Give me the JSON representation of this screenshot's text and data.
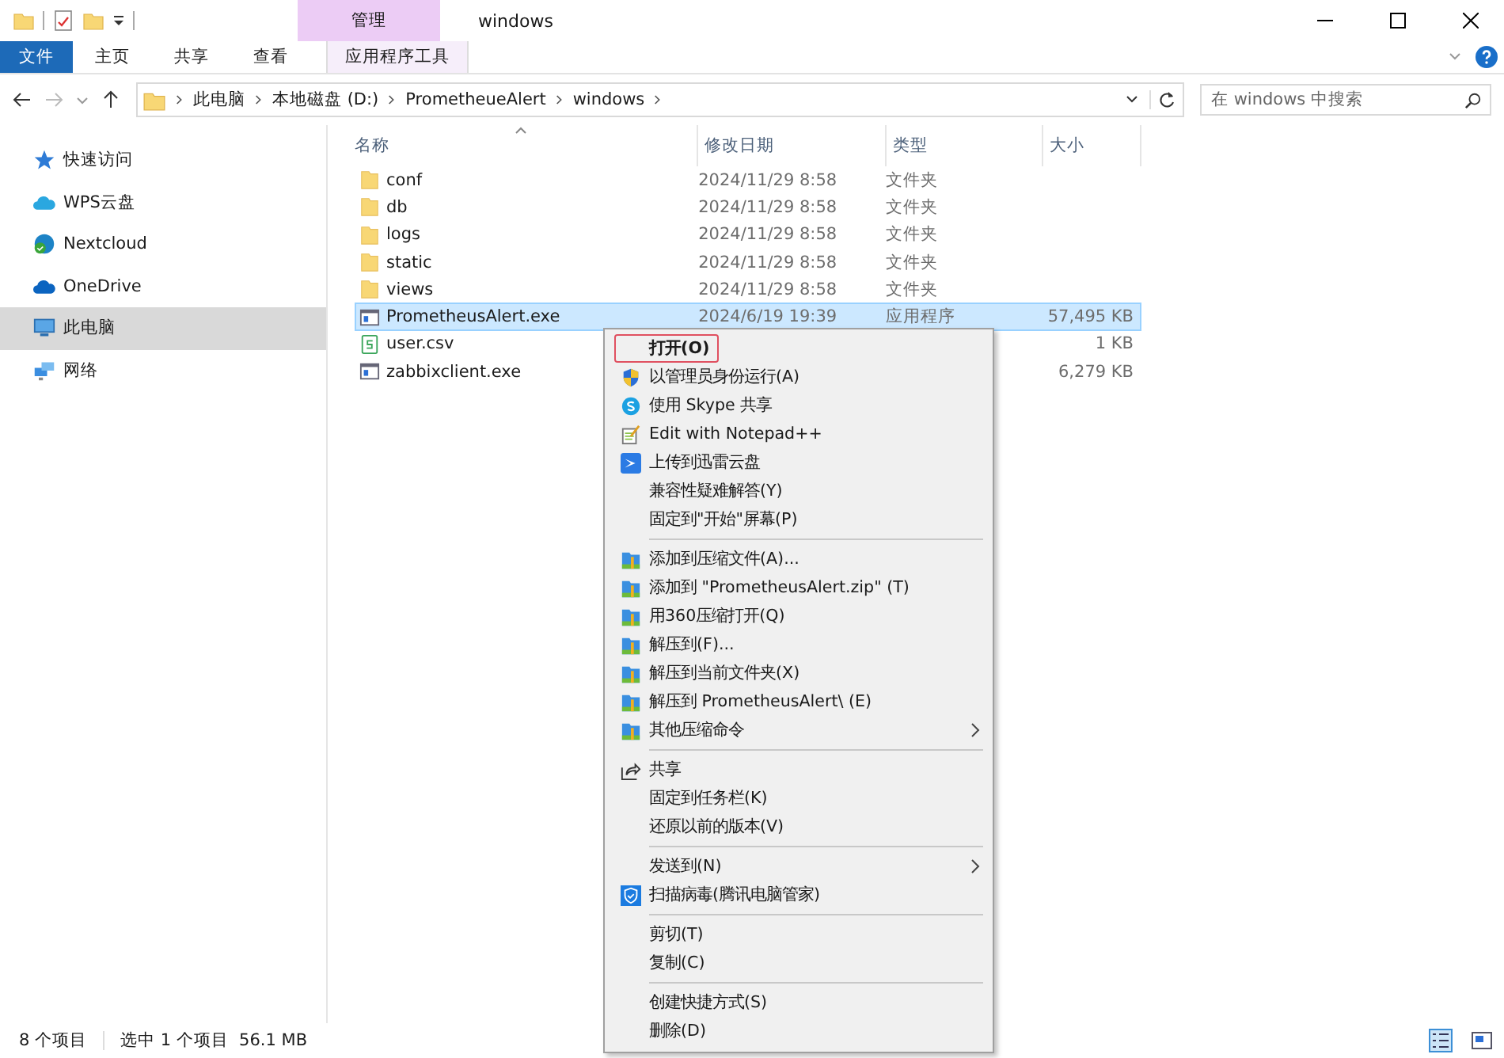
{
  "window": {
    "title": "windows",
    "context_tab": "管理"
  },
  "ribbon": {
    "tabs": [
      {
        "label": "文件",
        "kind": "file"
      },
      {
        "label": "主页",
        "kind": "plain"
      },
      {
        "label": "共享",
        "kind": "plain"
      },
      {
        "label": "查看",
        "kind": "plain"
      },
      {
        "label": "应用程序工具",
        "kind": "context"
      }
    ]
  },
  "address": {
    "crumbs": [
      "此电脑",
      "本地磁盘 (D:)",
      "PrometheueAlert",
      "windows"
    ],
    "search_placeholder": "在 windows 中搜索"
  },
  "sidebar": {
    "items": [
      {
        "label": "快速访问",
        "kind": "star",
        "selected": false
      },
      {
        "label": "WPS云盘",
        "kind": "cloud",
        "selected": false
      },
      {
        "label": "Nextcloud",
        "kind": "nextcloud",
        "selected": false
      },
      {
        "label": "OneDrive",
        "kind": "onedrive",
        "selected": false
      },
      {
        "label": "此电脑",
        "kind": "pc",
        "selected": true
      },
      {
        "label": "网络",
        "kind": "network",
        "selected": false
      }
    ]
  },
  "table": {
    "columns": [
      "名称",
      "修改日期",
      "类型",
      "大小"
    ],
    "rows": [
      {
        "name": "conf",
        "date": "2024/11/29 8:58",
        "type": "文件夹",
        "size": "",
        "kind": "folder",
        "selected": false
      },
      {
        "name": "db",
        "date": "2024/11/29 8:58",
        "type": "文件夹",
        "size": "",
        "kind": "folder",
        "selected": false
      },
      {
        "name": "logs",
        "date": "2024/11/29 8:58",
        "type": "文件夹",
        "size": "",
        "kind": "folder",
        "selected": false
      },
      {
        "name": "static",
        "date": "2024/11/29 8:58",
        "type": "文件夹",
        "size": "",
        "kind": "folder",
        "selected": false
      },
      {
        "name": "views",
        "date": "2024/11/29 8:58",
        "type": "文件夹",
        "size": "",
        "kind": "folder",
        "selected": false
      },
      {
        "name": "PrometheusAlert.exe",
        "date": "2024/6/19 19:39",
        "type": "应用程序",
        "size": "57,495 KB",
        "kind": "exe",
        "selected": true
      },
      {
        "name": "user.csv",
        "date": "",
        "type": "",
        "size": "1 KB",
        "kind": "csv",
        "selected": false
      },
      {
        "name": "zabbixclient.exe",
        "date": "",
        "type": "",
        "size": "6,279 KB",
        "kind": "exe",
        "selected": false
      }
    ]
  },
  "context_menu": {
    "groups": [
      [
        {
          "label": "打开(O)",
          "kind": "plain",
          "default": true,
          "highlighted": true,
          "submenu": false
        },
        {
          "label": "以管理员身份运行(A)",
          "kind": "shield",
          "default": false,
          "highlighted": false,
          "submenu": false
        },
        {
          "label": "使用 Skype 共享",
          "kind": "skype",
          "default": false,
          "highlighted": false,
          "submenu": false
        },
        {
          "label": "Edit with Notepad++",
          "kind": "notepad",
          "default": false,
          "highlighted": false,
          "submenu": false
        },
        {
          "label": "上传到迅雷云盘",
          "kind": "bird",
          "default": false,
          "highlighted": false,
          "submenu": false
        },
        {
          "label": "兼容性疑难解答(Y)",
          "kind": "plain",
          "default": false,
          "highlighted": false,
          "submenu": false
        },
        {
          "label": "固定到\"开始\"屏幕(P)",
          "kind": "plain",
          "default": false,
          "highlighted": false,
          "submenu": false
        }
      ],
      [
        {
          "label": "添加到压缩文件(A)...",
          "kind": "archive",
          "default": false,
          "highlighted": false,
          "submenu": false
        },
        {
          "label": "添加到 \"PrometheusAlert.zip\" (T)",
          "kind": "archive",
          "default": false,
          "highlighted": false,
          "submenu": false
        },
        {
          "label": "用360压缩打开(Q)",
          "kind": "archive",
          "default": false,
          "highlighted": false,
          "submenu": false
        },
        {
          "label": "解压到(F)...",
          "kind": "archive",
          "default": false,
          "highlighted": false,
          "submenu": false
        },
        {
          "label": "解压到当前文件夹(X)",
          "kind": "archive",
          "default": false,
          "highlighted": false,
          "submenu": false
        },
        {
          "label": "解压到 PrometheusAlert\\ (E)",
          "kind": "archive",
          "default": false,
          "highlighted": false,
          "submenu": false
        },
        {
          "label": "其他压缩命令",
          "kind": "archive",
          "default": false,
          "highlighted": false,
          "submenu": true
        }
      ],
      [
        {
          "label": "共享",
          "kind": "share",
          "default": false,
          "highlighted": false,
          "submenu": false
        },
        {
          "label": "固定到任务栏(K)",
          "kind": "plain",
          "default": false,
          "highlighted": false,
          "submenu": false
        },
        {
          "label": "还原以前的版本(V)",
          "kind": "plain",
          "default": false,
          "highlighted": false,
          "submenu": false
        }
      ],
      [
        {
          "label": "发送到(N)",
          "kind": "plain",
          "default": false,
          "highlighted": false,
          "submenu": true
        },
        {
          "label": "扫描病毒(腾讯电脑管家)",
          "kind": "virus",
          "default": false,
          "highlighted": false,
          "submenu": false
        }
      ],
      [
        {
          "label": "剪切(T)",
          "kind": "plain",
          "default": false,
          "highlighted": false,
          "submenu": false
        },
        {
          "label": "复制(C)",
          "kind": "plain",
          "default": false,
          "highlighted": false,
          "submenu": false
        }
      ],
      [
        {
          "label": "创建快捷方式(S)",
          "kind": "plain",
          "default": false,
          "highlighted": false,
          "submenu": false
        },
        {
          "label": "删除(D)",
          "kind": "plain",
          "default": false,
          "highlighted": false,
          "submenu": false
        }
      ]
    ]
  },
  "status_bar": {
    "count": "8 个项目",
    "selection": "选中 1 个项目  56.1 MB"
  }
}
